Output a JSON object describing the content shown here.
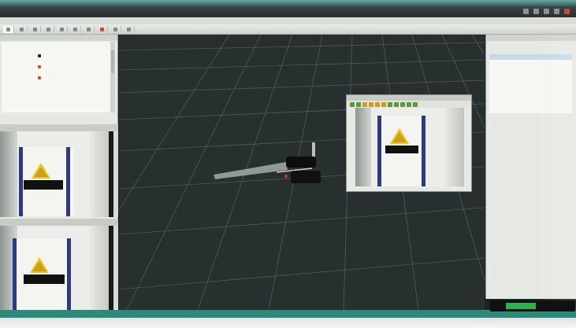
{
  "colors": {
    "viewport_bg": "#27302f",
    "grid_line": "#4b5a58",
    "accent_teal": "#2c8a78",
    "sign_yellow": "#f2c21b",
    "pillar_blue": "#2d3a7f",
    "record_green": "#2fb04f"
  },
  "icons": {
    "close": "close-icon",
    "minimize": "minimize-icon",
    "maximize": "maximize-icon",
    "camera": "camera-icon",
    "zoom": "zoom-icon",
    "save": "save-icon"
  }
}
